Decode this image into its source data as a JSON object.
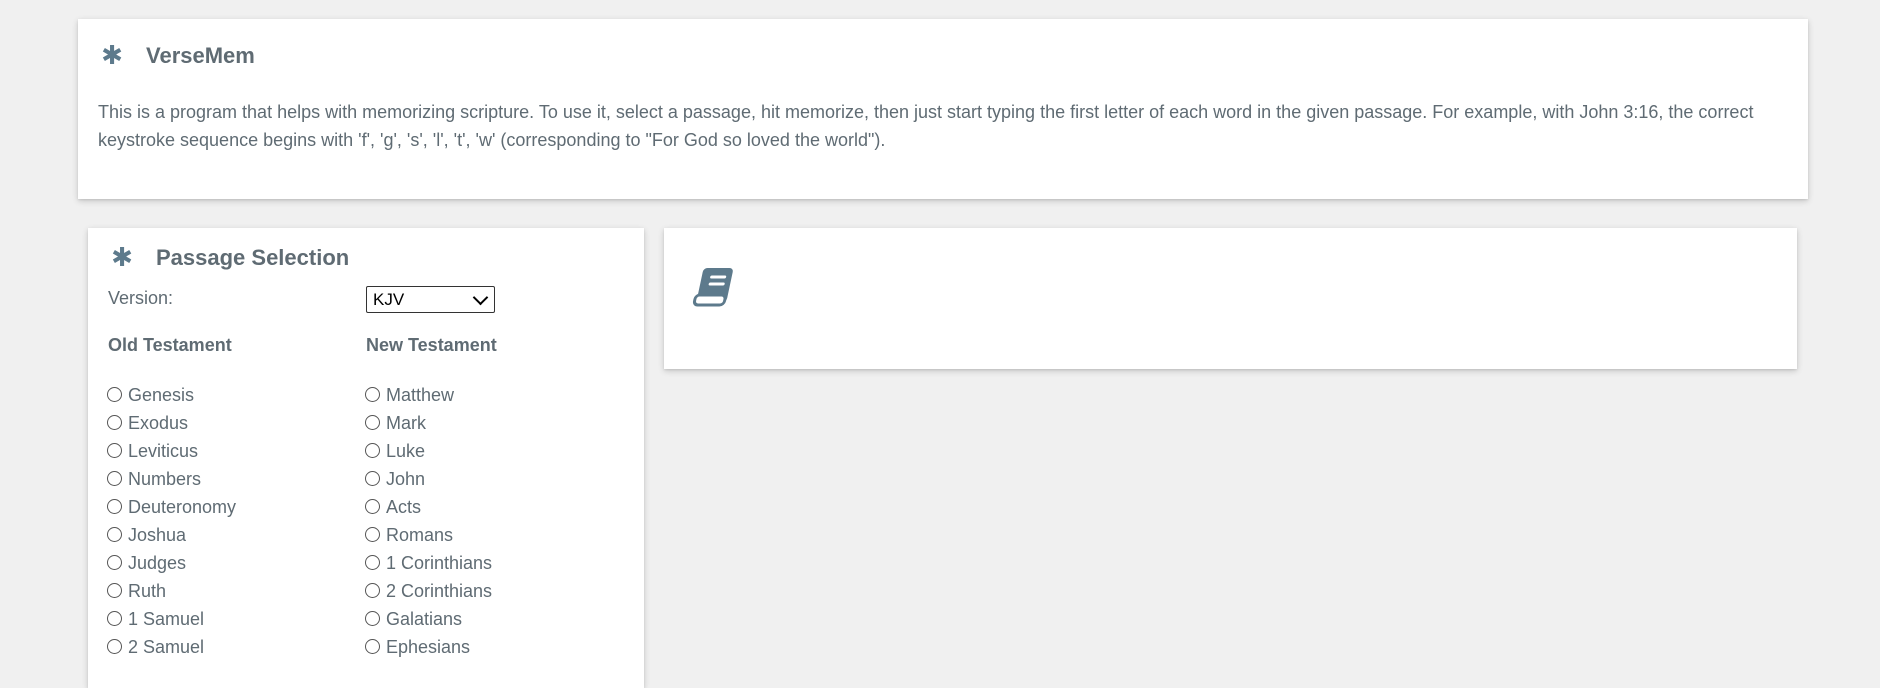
{
  "header": {
    "title": "VerseMem",
    "description": "This is a program that helps with memorizing scripture. To use it, select a passage, hit memorize, then just start typing the first letter of each word in the given passage. For example, with John 3:16, the correct keystroke sequence begins with 'f', 'g', 's', 'l', 't', 'w' (corresponding to \"For God so loved the world\")."
  },
  "selection": {
    "title": "Passage Selection",
    "version_label": "Version:",
    "version_value": "KJV",
    "old_testament_label": "Old Testament",
    "new_testament_label": "New Testament",
    "old_testament_books": [
      "Genesis",
      "Exodus",
      "Leviticus",
      "Numbers",
      "Deuteronomy",
      "Joshua",
      "Judges",
      "Ruth",
      "1 Samuel",
      "2 Samuel"
    ],
    "new_testament_books": [
      "Matthew",
      "Mark",
      "Luke",
      "John",
      "Acts",
      "Romans",
      "1 Corinthians",
      "2 Corinthians",
      "Galatians",
      "Ephesians"
    ]
  },
  "icons": {
    "title_icon": "asterisk-icon",
    "passage_icon": "book-icon"
  },
  "colors": {
    "accent": "#5d7a8c",
    "text": "#5f6b73",
    "background": "#f0f0f0"
  }
}
